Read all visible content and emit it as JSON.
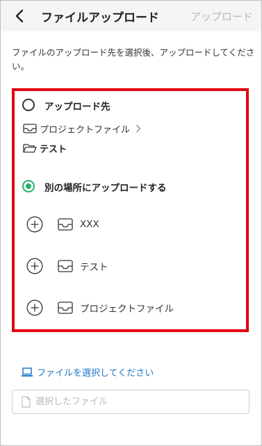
{
  "header": {
    "title": "ファイルアップロード",
    "upload_action": "アップロード",
    "back_icon": "chevron-left-icon"
  },
  "instructions": "ファイルのアップロード先を選択後、アップロードしてください。",
  "destination": {
    "upload_to_label": "アップロード先",
    "breadcrumb": "プロジェクトファイル",
    "folder": "テスト",
    "other_location_label": "別の場所にアップロードする",
    "selected_option": "other_location",
    "items": [
      {
        "label": "XXX"
      },
      {
        "label": "テスト"
      },
      {
        "label": "プロジェクトファイル"
      }
    ]
  },
  "file_select": {
    "link_label": "ファイルを選択してください",
    "placeholder": "選択したファイル",
    "value": ""
  },
  "colors": {
    "accent_green": "#26b26a",
    "link_blue": "#1e78c8",
    "highlight_red": "#e3000f",
    "disabled_gray": "#b8b8b8"
  }
}
